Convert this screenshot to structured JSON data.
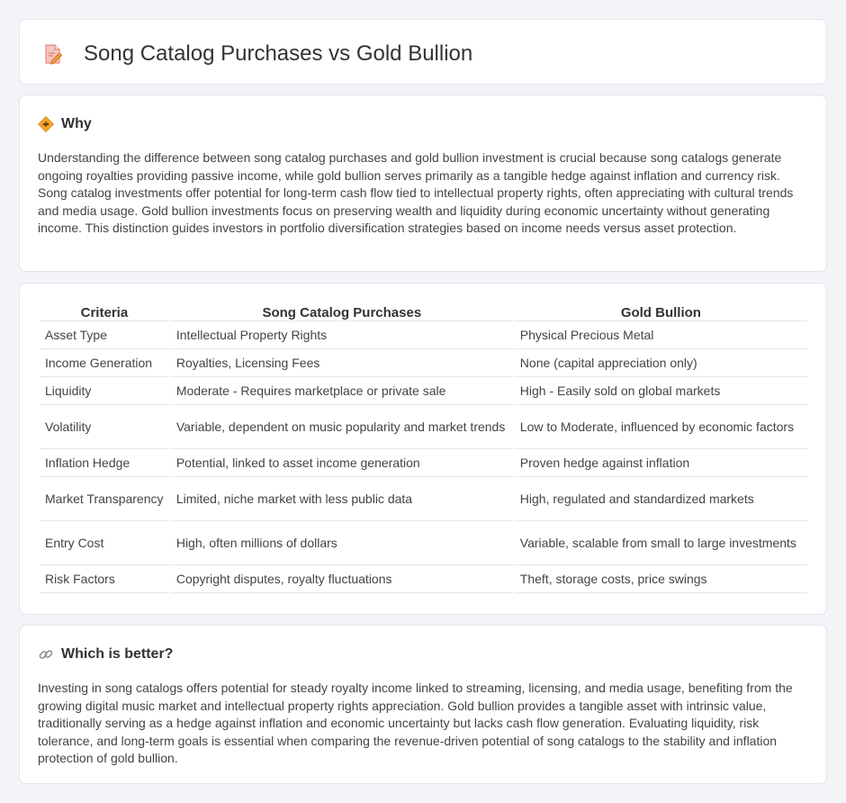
{
  "header": {
    "title": "Song Catalog Purchases vs Gold Bullion",
    "icon": "document-pencil-icon"
  },
  "why": {
    "icon": "diamond-sign-icon",
    "heading": "Why",
    "text": "Understanding the difference between song catalog purchases and gold bullion investment is crucial because song catalogs generate ongoing royalties providing passive income, while gold bullion serves primarily as a tangible hedge against inflation and currency risk. Song catalog investments offer potential for long-term cash flow tied to intellectual property rights, often appreciating with cultural trends and media usage. Gold bullion investments focus on preserving wealth and liquidity during economic uncertainty without generating income. This distinction guides investors in portfolio diversification strategies based on income needs versus asset protection."
  },
  "table": {
    "headers": [
      "Criteria",
      "Song Catalog Purchases",
      "Gold Bullion"
    ],
    "rows": [
      [
        "Asset Type",
        "Intellectual Property Rights",
        "Physical Precious Metal"
      ],
      [
        "Income Generation",
        "Royalties, Licensing Fees",
        "None (capital appreciation only)"
      ],
      [
        "Liquidity",
        "Moderate - Requires marketplace or private sale",
        "High - Easily sold on global markets"
      ],
      [
        "Volatility",
        "Variable, dependent on music popularity and market trends",
        "Low to Moderate, influenced by economic factors"
      ],
      [
        "Inflation Hedge",
        "Potential, linked to asset income generation",
        "Proven hedge against inflation"
      ],
      [
        "Market Transparency",
        "Limited, niche market with less public data",
        "High, regulated and standardized markets"
      ],
      [
        "Entry Cost",
        "High, often millions of dollars",
        "Variable, scalable from small to large investments"
      ],
      [
        "Risk Factors",
        "Copyright disputes, royalty fluctuations",
        "Theft, storage costs, price swings"
      ]
    ]
  },
  "better": {
    "icon": "link-icon",
    "heading": "Which is better?",
    "text": "Investing in song catalogs offers potential for steady royalty income linked to streaming, licensing, and media usage, benefiting from the growing digital music market and intellectual property rights appreciation. Gold bullion provides a tangible asset with intrinsic value, traditionally serving as a hedge against inflation and economic uncertainty but lacks cash flow generation. Evaluating liquidity, risk tolerance, and long-term goals is essential when comparing the revenue-driven potential of song catalogs to the stability and inflation protection of gold bullion."
  },
  "colors": {
    "background": "#f3f4f8",
    "card": "#ffffff",
    "accent_orange": "#f0a030",
    "icon_pink": "#e88a8a"
  }
}
